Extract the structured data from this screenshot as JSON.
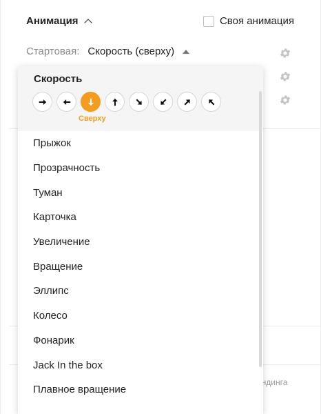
{
  "section": {
    "title": "Анимация",
    "custom_animation_label": "Своя анимация"
  },
  "start": {
    "label": "Стартовая:",
    "value": "Скорость (сверху)"
  },
  "dropdown": {
    "group_title": "Скорость",
    "directions": [
      {
        "icon": "arrow-right-icon",
        "selected": false
      },
      {
        "icon": "arrow-left-icon",
        "selected": false
      },
      {
        "icon": "arrow-down-icon",
        "selected": true
      },
      {
        "icon": "arrow-up-icon",
        "selected": false
      },
      {
        "icon": "arrow-down-right-icon",
        "selected": false
      },
      {
        "icon": "arrow-down-left-icon",
        "selected": false
      },
      {
        "icon": "arrow-up-right-icon",
        "selected": false
      },
      {
        "icon": "arrow-up-left-icon",
        "selected": false
      }
    ],
    "selected_direction_label": "Сверху",
    "items": [
      "Прыжок",
      "Прозрачность",
      "Туман",
      "Карточка",
      "Увеличение",
      "Вращение",
      "Эллипс",
      "Колесо",
      "Фонарик",
      "Jack In the box",
      "Плавное вращение"
    ]
  },
  "background": {
    "landing_fragment": "ендинга"
  },
  "colors": {
    "accent": "#f39c1f",
    "muted": "#888888"
  }
}
